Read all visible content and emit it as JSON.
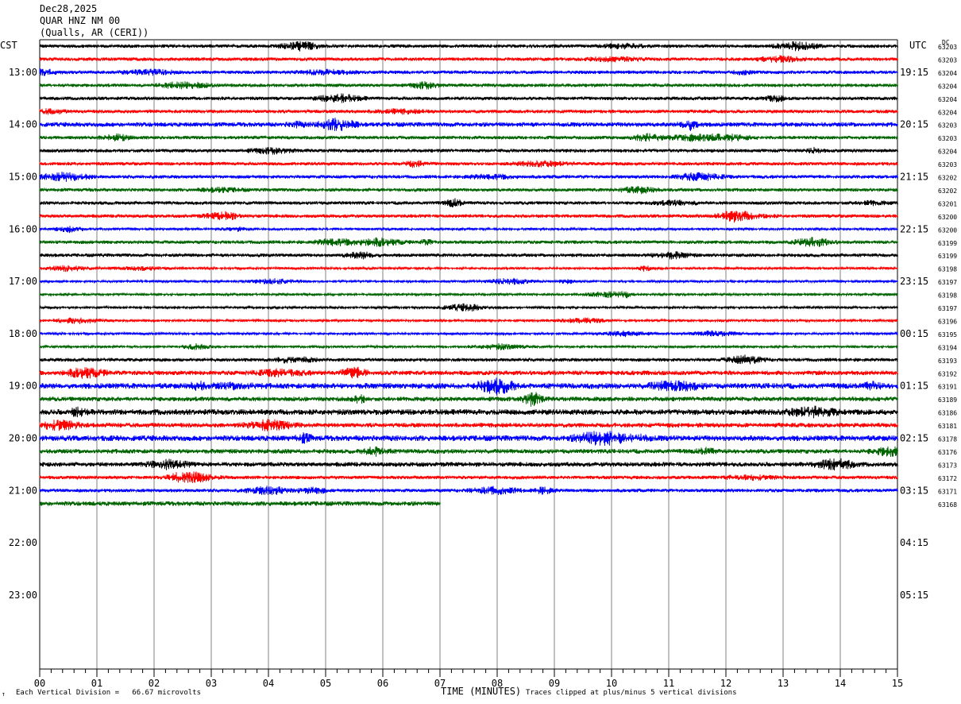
{
  "header": {
    "date": "Dec28,2025",
    "station": "QUAR HNZ NM 00",
    "location": "(Qualls, AR (CERI))"
  },
  "left_timezone": "CST",
  "right_timezone": "UTC",
  "dc_label": "DC",
  "footer": {
    "mark": "↑",
    "scale_note": "Each Vertical Division =   66.67 microvolts",
    "clip_note": "Traces clipped at plus/minus 5 vertical divisions"
  },
  "colors": {
    "trace": [
      "#000000",
      "#ff0000",
      "#0000ff",
      "#006400"
    ],
    "grid": "#808080",
    "axis": "#000000"
  },
  "chart_data": {
    "type": "line",
    "title": "QUAR HNZ NM 00",
    "xlabel": "TIME (MINUTES)",
    "ylabel": "",
    "xlim": [
      0,
      15
    ],
    "x_ticks": [
      "00",
      "01",
      "02",
      "03",
      "04",
      "05",
      "06",
      "07",
      "08",
      "09",
      "10",
      "11",
      "12",
      "13",
      "14",
      "15"
    ],
    "rows_per_hour": 4,
    "left_hour_labels": [
      "13:00",
      "14:00",
      "15:00",
      "16:00",
      "17:00",
      "18:00",
      "19:00",
      "20:00",
      "21:00",
      "22:00",
      "23:00"
    ],
    "right_hour_labels": [
      "19:15",
      "20:15",
      "21:15",
      "22:15",
      "23:15",
      "00:15",
      "01:15",
      "02:15",
      "03:15",
      "04:15",
      "05:15"
    ],
    "row_dc_offsets": [
      "63203",
      "63203",
      "63204",
      "63204",
      "63204",
      "63204",
      "63203",
      "63203",
      "63204",
      "63203",
      "63202",
      "63202",
      "63201",
      "63200",
      "63200",
      "63199",
      "63199",
      "63198",
      "63197",
      "63198",
      "63197",
      "63196",
      "63195",
      "63194",
      "63193",
      "63192",
      "63191",
      "63189",
      "63186",
      "63181",
      "63178",
      "63176",
      "63173",
      "63172",
      "63171",
      "63168"
    ],
    "row_activity": [
      2,
      2,
      2,
      2,
      2,
      2,
      3,
      2,
      2,
      2,
      2,
      2,
      2,
      2,
      1,
      2,
      2,
      1,
      1,
      1,
      1,
      1,
      1,
      1,
      2,
      3,
      4,
      3,
      4,
      3,
      4,
      3,
      3,
      2,
      2,
      3
    ],
    "last_row_end_minute": 7.0
  }
}
